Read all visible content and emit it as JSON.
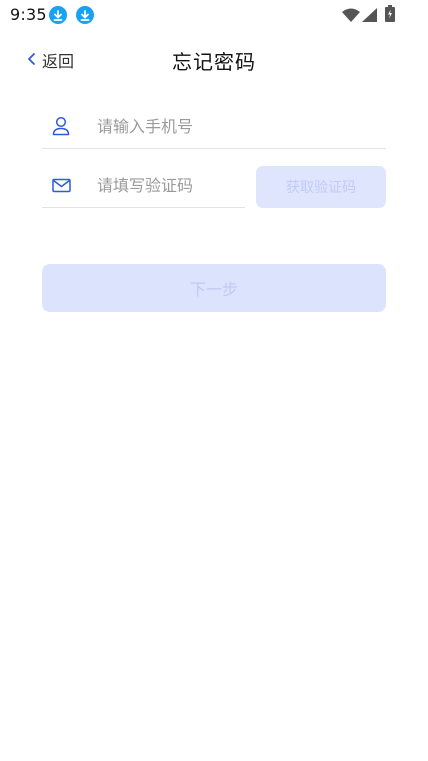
{
  "status_bar": {
    "time": "9:35",
    "icons": [
      "download-icon",
      "download-icon",
      "wifi-icon",
      "signal-icon",
      "battery-icon"
    ]
  },
  "header": {
    "back_label": "返回",
    "title": "忘记密码"
  },
  "form": {
    "phone": {
      "placeholder": "请输入手机号",
      "value": ""
    },
    "code": {
      "placeholder": "请填写验证码",
      "value": ""
    },
    "get_code_label": "获取验证码",
    "next_label": "下一步"
  },
  "colors": {
    "accent": "#2f5ae0",
    "disabled_button_bg": "#dbe3fd",
    "disabled_button_text": "#bfcaf6",
    "download_badge": "#1aa2f2"
  }
}
